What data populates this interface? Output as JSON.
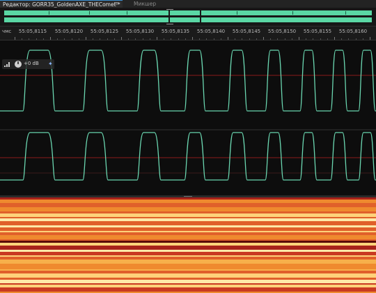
{
  "tabs": {
    "editor_tab": "Редактор: GORR35_GoldenAXE_THEComet *",
    "menu_glyph": "≡",
    "mixer_tab": "Микшер"
  },
  "ruler": {
    "unit": "чмс",
    "labels": [
      "55:05,8115",
      "55:05,8120",
      "55:05,8125",
      "55:05,8130",
      "55:05,8135",
      "55:05,8140",
      "55:05,8145",
      "55:05,8150",
      "55:05,8155",
      "55:05,8160"
    ]
  },
  "volume_hud": {
    "label": "+0 dB",
    "icons": [
      "volume-bars-icon",
      "volume-knob-icon",
      "pin-icon"
    ]
  },
  "colors": {
    "waveform": "#6ad6b0",
    "overview": "#5ad7a4",
    "center_line": "#8a1c1c",
    "playhead": "#c8c8c8",
    "spectral_hot": "#ffe7a0",
    "spectral_mid": "#f2a23a",
    "spectral_cool": "#c0281c"
  }
}
